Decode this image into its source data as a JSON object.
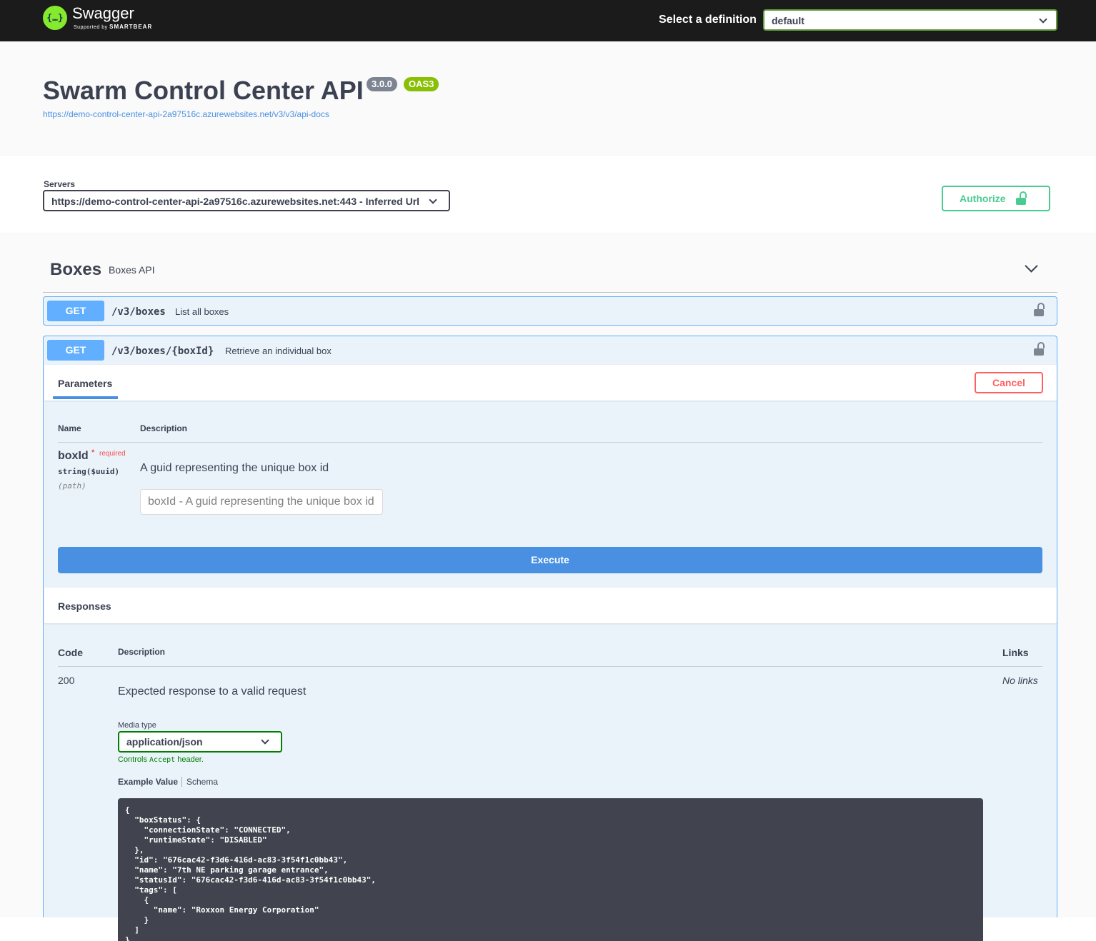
{
  "topbar": {
    "logo_name": "Swagger",
    "logo_sub_prefix": "Supported by",
    "logo_sub_brand": "SMARTBEAR",
    "definition_label": "Select a definition",
    "definition_value": "default"
  },
  "info": {
    "title": "Swarm Control Center API",
    "version": "3.0.0",
    "oas": "OAS3",
    "url": "https://demo-control-center-api-2a97516c.azurewebsites.net/v3/v3/api-docs"
  },
  "servers": {
    "label": "Servers",
    "selected": "https://demo-control-center-api-2a97516c.azurewebsites.net:443 - Inferred Url"
  },
  "authorize_label": "Authorize",
  "tag": {
    "name": "Boxes",
    "description": "Boxes API"
  },
  "operations": [
    {
      "method": "GET",
      "path": "/v3/boxes",
      "summary": "List all boxes"
    },
    {
      "method": "GET",
      "path": "/v3/boxes/{boxId}",
      "summary": "Retrieve an individual box"
    }
  ],
  "parameters": {
    "tab_label": "Parameters",
    "cancel_label": "Cancel",
    "col_name": "Name",
    "col_description": "Description",
    "param": {
      "name": "boxId",
      "star": "*",
      "required": "required",
      "type": "string($uuid)",
      "in": "(path)",
      "description": "A guid representing the unique box id",
      "placeholder": "boxId - A guid representing the unique box id"
    },
    "execute_label": "Execute"
  },
  "responses": {
    "title": "Responses",
    "col_code": "Code",
    "col_description": "Description",
    "col_links": "Links",
    "code": "200",
    "description": "Expected response to a valid request",
    "links": "No links",
    "media_type_label": "Media type",
    "media_type": "application/json",
    "controls_prefix": "Controls",
    "controls_code": "Accept",
    "controls_suffix": "header.",
    "tab_example": "Example Value",
    "tab_schema": "Schema",
    "example_json": "{\n  \"boxStatus\": {\n    \"connectionState\": \"CONNECTED\",\n    \"runtimeState\": \"DISABLED\"\n  },\n  \"id\": \"676cac42-f3d6-416d-ac83-3f54f1c0bb43\",\n  \"name\": \"7th NE parking garage entrance\",\n  \"statusId\": \"676cac42-f3d6-416d-ac83-3f54f1c0bb43\",\n  \"tags\": [\n    {\n      \"name\": \"Roxxon Energy Corporation\"\n    }\n  ]\n}"
  }
}
